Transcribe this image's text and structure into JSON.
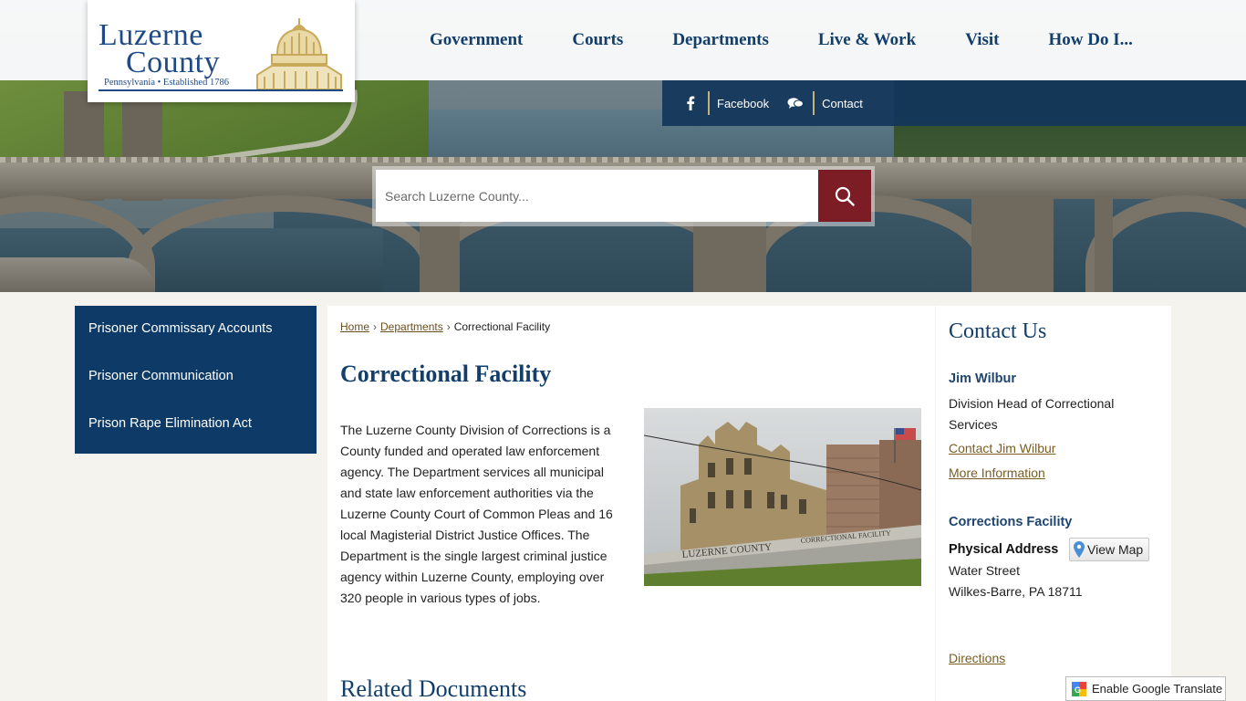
{
  "logo": {
    "line1": "Luzerne",
    "line2": "County",
    "tagline": "Pennsylvania • Established 1786"
  },
  "nav": {
    "items": [
      "Government",
      "Courts",
      "Departments",
      "Live & Work",
      "Visit",
      "How Do I..."
    ]
  },
  "social": {
    "facebook_label": "Facebook",
    "contact_label": "Contact"
  },
  "search": {
    "placeholder": "Search Luzerne County..."
  },
  "sidebar_nav": {
    "items": [
      "Prisoner Commissary Accounts",
      "Prisoner Communication",
      "Prison Rape Elimination Act"
    ]
  },
  "breadcrumb": {
    "home": "Home",
    "departments": "Departments",
    "current": "Correctional Facility",
    "separator": "›"
  },
  "page": {
    "title": "Correctional Facility",
    "body": "The Luzerne County Division of Corrections is a County funded and operated law enforcement agency. The Department services all municipal and state law enforcement authorities via the Luzerne County Court of Common Pleas and 16 local Magisterial District Justice Offices. The Department is the single largest criminal justice agency within Luzerne County, employing over 320 people in various types of jobs.",
    "related_heading": "Related Documents",
    "photo_sign": "LUZERNE COUNTY",
    "photo_sign2": "CORRECTIONAL FACILITY"
  },
  "contact": {
    "heading": "Contact Us",
    "name": "Jim Wilbur",
    "role": "Division Head of Correctional Services",
    "contact_link": "Contact Jim Wilbur",
    "more_info_link": "More Information",
    "facility": "Corrections Facility",
    "physical_address_label": "Physical Address",
    "view_map_label": "View Map",
    "street": "Water Street",
    "city": "Wilkes-Barre, PA 18711",
    "directions_link": "Directions"
  },
  "translate": {
    "label": "Enable Google Translate"
  },
  "colors": {
    "navy": "#123e6b",
    "leftnav_bg": "#0d3a66",
    "search_button": "#7c1d26",
    "link_gold": "#7a5d20",
    "logo_gold": "#c9a95a"
  }
}
